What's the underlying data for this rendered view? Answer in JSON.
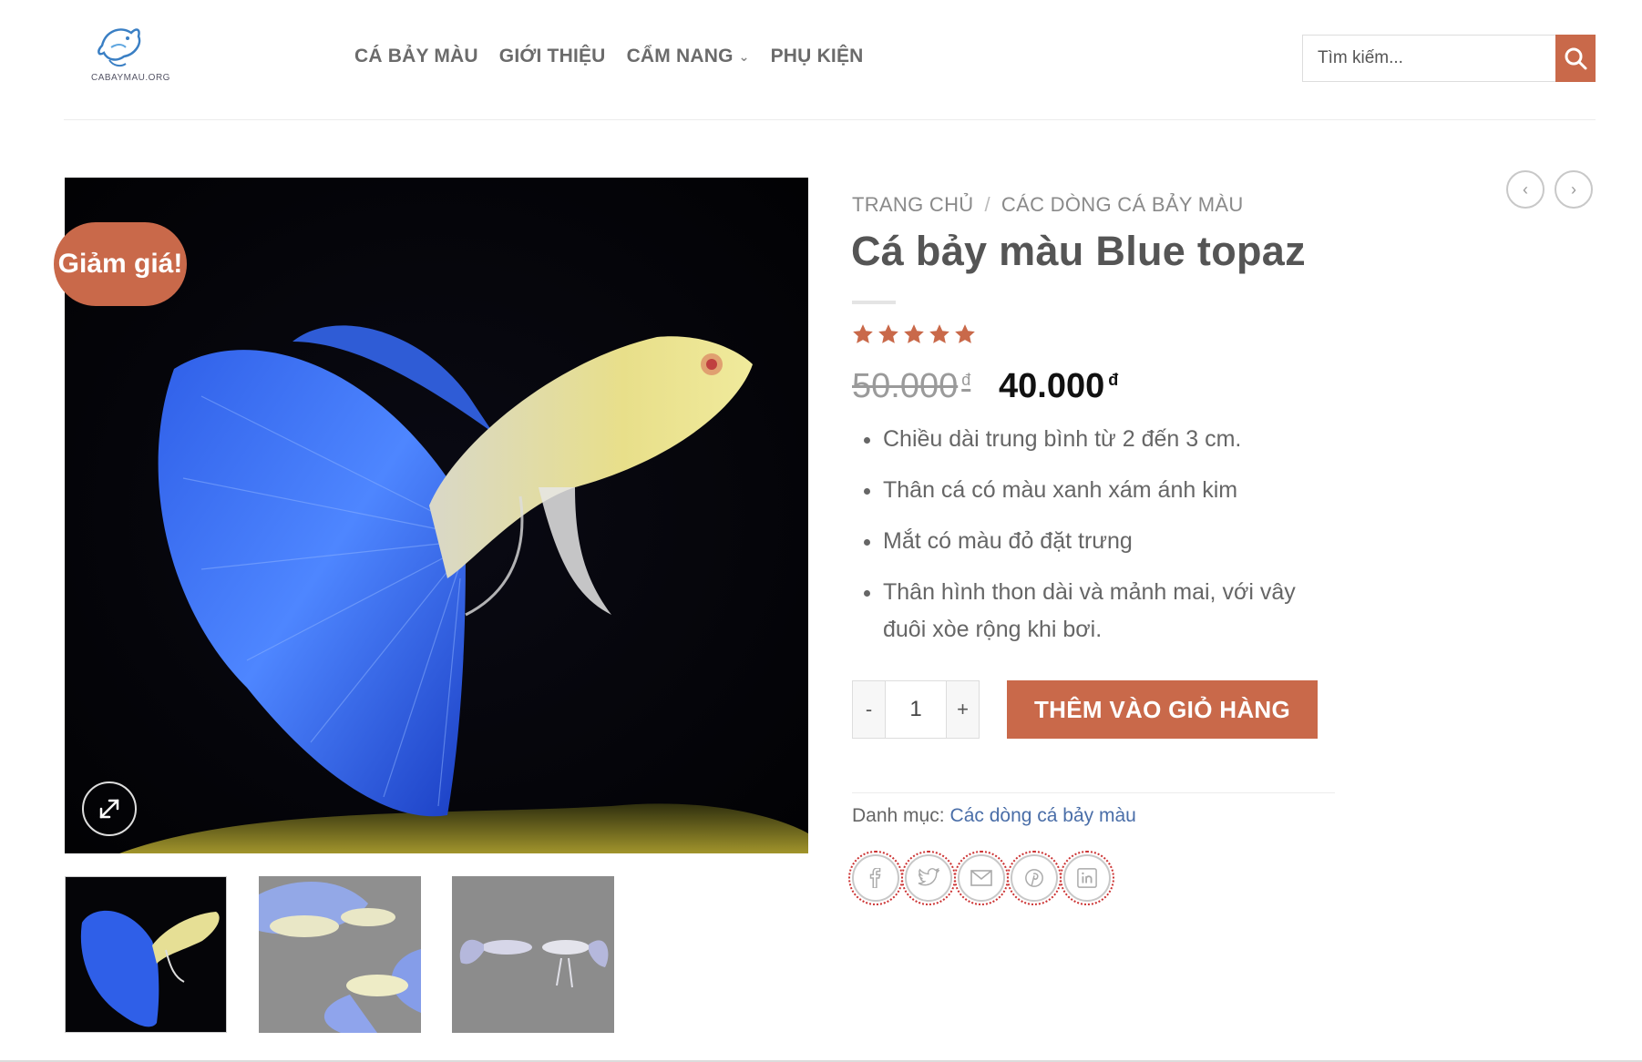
{
  "header": {
    "logo_text": "CABAYMAU.ORG",
    "nav": [
      {
        "label": "CÁ BẢY MÀU"
      },
      {
        "label": "GIỚI THIỆU"
      },
      {
        "label": "CẨM NANG",
        "has_dropdown": true
      },
      {
        "label": "PHỤ KIỆN"
      }
    ],
    "search_placeholder": "Tìm kiếm...",
    "icons": {
      "search": "search-icon",
      "dropdown": "chevron-down-icon"
    }
  },
  "gallery": {
    "sale_badge": "Giảm giá!",
    "icons": {
      "zoom": "expand-icon"
    },
    "thumbnail_count": 3
  },
  "product": {
    "breadcrumb": [
      "TRANG CHỦ",
      "CÁC DÒNG CÁ BẢY MÀU"
    ],
    "breadcrumb_sep": "/",
    "title": "Cá bảy màu Blue topaz",
    "rating": 5,
    "rating_max": 5,
    "price_old": "50.000",
    "price_new": "40.000",
    "currency": "đ",
    "features": [
      "Chiều dài trung bình từ 2 đến 3 cm.",
      "Thân cá có màu xanh xám ánh kim",
      "Mắt có màu đỏ đặt trưng",
      "Thân hình thon dài và mảnh mai, với vây đuôi xòe rộng khi bơi."
    ],
    "qty_minus": "-",
    "qty_plus": "+",
    "qty_value": "1",
    "add_to_cart": "THÊM VÀO GIỎ HÀNG",
    "category_label": "Danh mục:",
    "category_value": "Các dòng cá bảy màu",
    "share_icons": [
      "facebook-icon",
      "twitter-icon",
      "email-icon",
      "pinterest-icon",
      "linkedin-icon"
    ]
  },
  "colors": {
    "accent": "#c9694a",
    "link": "#4a6ea8",
    "star": "#c9694a"
  }
}
